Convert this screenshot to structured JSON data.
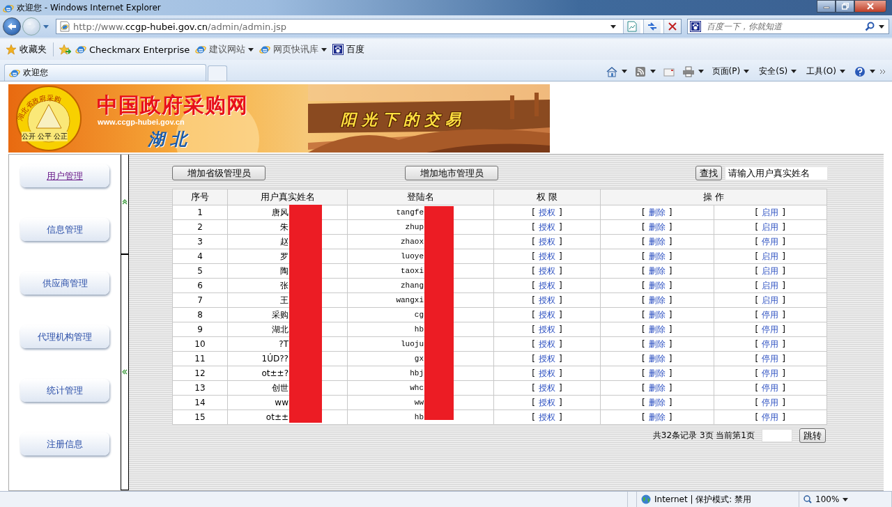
{
  "window": {
    "title": "欢迎您 - Windows Internet Explorer"
  },
  "address_bar": {
    "url": "http://www.ccgp-hubei.gov.cn/admin/admin.jsp"
  },
  "search_box": {
    "placeholder": "百度一下，你就知道"
  },
  "favorites_bar": {
    "label": "收藏夹",
    "items": [
      {
        "label": "Checkmarx Enterprise",
        "kind": "page",
        "dropdown": false
      },
      {
        "label": "建议网站",
        "kind": "page",
        "dropdown": true
      },
      {
        "label": "网页快讯库",
        "kind": "page",
        "dropdown": true
      },
      {
        "label": "百度",
        "kind": "paw",
        "dropdown": false
      }
    ]
  },
  "tabs": [
    {
      "label": "欢迎您",
      "selected": true
    }
  ],
  "command_bar": {
    "menus": [
      "页面(P)",
      "安全(S)",
      "工具(O)"
    ]
  },
  "banner": {
    "logo_ring": "湖北省政府采购",
    "logo_motto": "公开 公平 公正",
    "title": "中国政府采购网",
    "url": "www.ccgp-hubei.gov.cn",
    "region": "湖 北",
    "slogan": "阳光下的交易"
  },
  "sidebar": {
    "items": [
      {
        "label": "用户管理",
        "selected": true
      },
      {
        "label": "信息管理",
        "selected": false
      },
      {
        "label": "供应商管理",
        "selected": false
      },
      {
        "label": "代理机构管理",
        "selected": false
      },
      {
        "label": "统计管理",
        "selected": false
      },
      {
        "label": "注册信息",
        "selected": false
      }
    ]
  },
  "toolbar": {
    "buttons": [
      "增加省级管理员",
      "增加地市管理员"
    ],
    "search_button": "查找",
    "search_value": "请输入用户真实姓名"
  },
  "table": {
    "columns": [
      {
        "label": "序号",
        "redacted": false
      },
      {
        "label": "用户真实姓名",
        "redacted": true
      },
      {
        "label": "登陆名",
        "redacted": true
      },
      {
        "label": "权 限",
        "redacted": false
      },
      {
        "label": "操 作",
        "redacted": false
      }
    ],
    "bracket_open": "[",
    "bracket_close": "]",
    "rows": [
      {
        "no": "1",
        "name": "唐风",
        "login": "tangfe",
        "grant": "授权",
        "delete": "删除",
        "toggle": "启用"
      },
      {
        "no": "2",
        "name": "朱",
        "login": "zhup",
        "grant": "授权",
        "delete": "删除",
        "toggle": "启用"
      },
      {
        "no": "3",
        "name": "赵",
        "login": "zhaox",
        "grant": "授权",
        "delete": "删除",
        "toggle": "停用"
      },
      {
        "no": "4",
        "name": "罗",
        "login": "luoye",
        "grant": "授权",
        "delete": "删除",
        "toggle": "启用"
      },
      {
        "no": "5",
        "name": "陶",
        "login": "taoxi",
        "grant": "授权",
        "delete": "删除",
        "toggle": "启用"
      },
      {
        "no": "6",
        "name": "张",
        "login": "zhang",
        "grant": "授权",
        "delete": "删除",
        "toggle": "启用"
      },
      {
        "no": "7",
        "name": "王",
        "login": "wangxi",
        "grant": "授权",
        "delete": "删除",
        "toggle": "启用"
      },
      {
        "no": "8",
        "name": "采购",
        "login": "cg",
        "grant": "授权",
        "delete": "删除",
        "toggle": "停用"
      },
      {
        "no": "9",
        "name": "湖北",
        "login": "hb",
        "grant": "授权",
        "delete": "删除",
        "toggle": "停用"
      },
      {
        "no": "10",
        "name": "?T",
        "login": "luoju",
        "grant": "授权",
        "delete": "删除",
        "toggle": "停用"
      },
      {
        "no": "11",
        "name": "1ÚD??",
        "login": "gx",
        "grant": "授权",
        "delete": "删除",
        "toggle": "停用"
      },
      {
        "no": "12",
        "name": "ot±±?",
        "login": "hbj",
        "grant": "授权",
        "delete": "删除",
        "toggle": "停用"
      },
      {
        "no": "13",
        "name": "创世",
        "login": "whc",
        "grant": "授权",
        "delete": "删除",
        "toggle": "停用"
      },
      {
        "no": "14",
        "name": "ww",
        "login": "ww",
        "grant": "授权",
        "delete": "删除",
        "toggle": "停用"
      },
      {
        "no": "15",
        "name": "ot±±",
        "login": "hb",
        "grant": "授权",
        "delete": "删除",
        "toggle": "停用"
      }
    ]
  },
  "pager": {
    "summary": "共32条记录 3页 当前第1页",
    "jump_button": "跳转"
  },
  "status_bar": {
    "zone": "Internet | 保护模式: 禁用",
    "zoom": "100%"
  }
}
